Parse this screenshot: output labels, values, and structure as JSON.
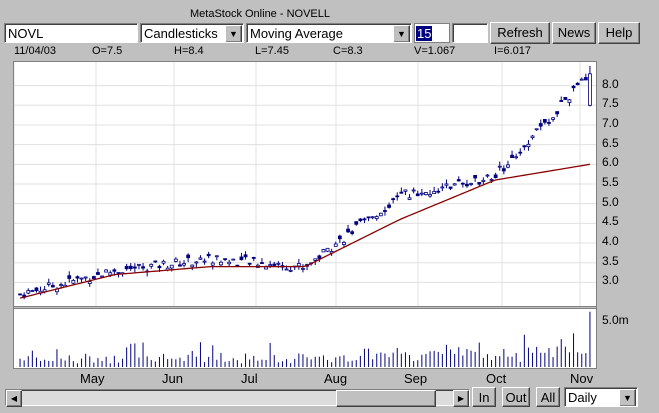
{
  "window": {
    "title": "MetaStock Online - NOVELL"
  },
  "toolbar": {
    "symbol_value": "NOVL",
    "chart_type_value": "Candlesticks",
    "indicator_value": "Moving Average",
    "period_value": "15",
    "refresh_label": "Refresh",
    "news_label": "News",
    "help_label": "Help"
  },
  "quote": {
    "date": "11/04/03",
    "open": "O=7.5",
    "high": "H=8.4",
    "low": "L=7.45",
    "close": "C=8.3",
    "volume": "V=1.067",
    "indicator": "I=6.017"
  },
  "price_axis": [
    "8.0",
    "7.5",
    "7.0",
    "6.5",
    "6.0",
    "5.5",
    "5.0",
    "4.5",
    "4.0",
    "3.5",
    "3.0"
  ],
  "volume_axis": [
    "5.0m"
  ],
  "months": [
    "May",
    "Jun",
    "Jul",
    "Aug",
    "Sep",
    "Oct",
    "Nov"
  ],
  "bottom": {
    "in_label": "In",
    "out_label": "Out",
    "all_label": "All",
    "period_value": "Daily"
  },
  "colors": {
    "candles": "#000080",
    "moving_average": "#8b0000",
    "volume": "#000080",
    "grid": "#e0e0e0"
  },
  "chart_data": {
    "type": "line",
    "title": "NOVELL",
    "ylim": [
      2.4,
      8.6
    ],
    "x": [
      "May",
      "Jun",
      "Jul",
      "Aug",
      "Sep",
      "Oct",
      "Nov"
    ],
    "series": [
      {
        "name": "Close",
        "values": [
          2.7,
          3.3,
          3.6,
          3.4,
          5.2,
          5.7,
          8.3
        ]
      },
      {
        "name": "Moving Average",
        "values": [
          2.6,
          3.2,
          3.4,
          3.4,
          4.6,
          5.6,
          6.0
        ]
      }
    ],
    "volume_ylim": [
      0,
      6.5
    ],
    "grid": true
  }
}
